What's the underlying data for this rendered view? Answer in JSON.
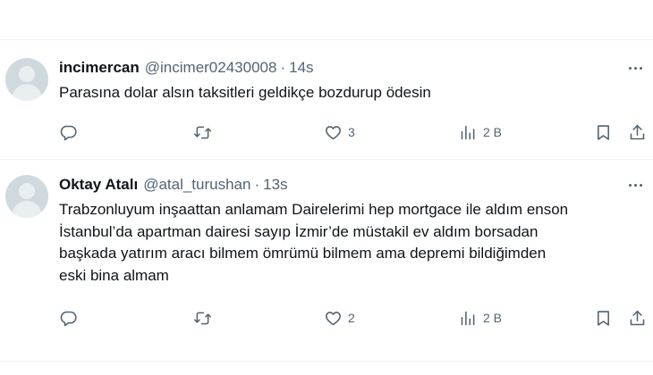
{
  "tweets": [
    {
      "name": "incimercan",
      "handle": "@incimer02430008",
      "separator": "·",
      "time": "14s",
      "text": "Parasına dolar alsın taksitleri geldikçe bozdurup ödesin",
      "likes": "3",
      "views": "2 B",
      "icons": [
        "reply-icon",
        "retweet-icon",
        "like-icon",
        "views-icon",
        "bookmark-icon",
        "share-icon",
        "more-icon"
      ]
    },
    {
      "name": "Oktay Atalı",
      "handle": "@atal_turushan",
      "separator": "·",
      "time": "13s",
      "text_lines": [
        "Trabzonluyum inşaattan anlamam Dairelerimi hep mortgace ile aldım enson",
        "İstanbul’da apartman dairesi sayıp İzmir’de müstakil ev aldım borsadan",
        "başkada yatırım aracı bilmem ömrümü bilmem ama depremi bildiğimden",
        "eski bina almam"
      ],
      "likes": "2",
      "views": "2 B",
      "icons": [
        "reply-icon",
        "retweet-icon",
        "like-icon",
        "views-icon",
        "bookmark-icon",
        "share-icon",
        "more-icon"
      ]
    }
  ],
  "colors": {
    "text": "#0f1419",
    "secondary": "#536471",
    "divider": "#eff3f4",
    "avatar": "#cfd9de"
  }
}
